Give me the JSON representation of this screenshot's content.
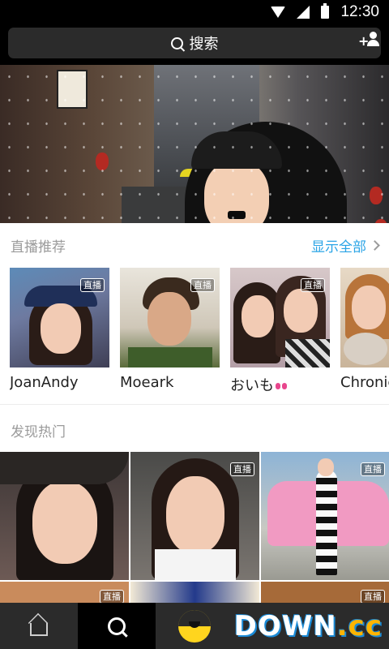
{
  "status_bar": {
    "time": "12:30"
  },
  "header": {
    "search_label": "搜索",
    "add_user_plus": "+"
  },
  "live_section": {
    "title": "直播推荐",
    "show_all": "显示全部",
    "cards": [
      {
        "name": "JoanAndy",
        "badge": "直播"
      },
      {
        "name": "Moeark",
        "badge": "直播"
      },
      {
        "name": "おいも",
        "badge": "直播"
      },
      {
        "name": "Chronic",
        "badge": ""
      }
    ]
  },
  "hot_section": {
    "title": "发现热门",
    "tiles": [
      {
        "badge": ""
      },
      {
        "badge": "直播"
      },
      {
        "badge": "直播"
      },
      {
        "badge": "直播"
      },
      {
        "badge": ""
      },
      {
        "badge": "直播"
      }
    ]
  },
  "bottom_nav": {
    "items": [
      "home-icon",
      "search-icon",
      "app-logo-icon",
      "profile"
    ]
  },
  "watermark": {
    "main": "DOWN",
    "suffix": ".cc"
  },
  "colors": {
    "accent_link": "#2aa4e6",
    "nav_bg": "#2b2b2b",
    "logo_yellow": "#ffd51e"
  }
}
